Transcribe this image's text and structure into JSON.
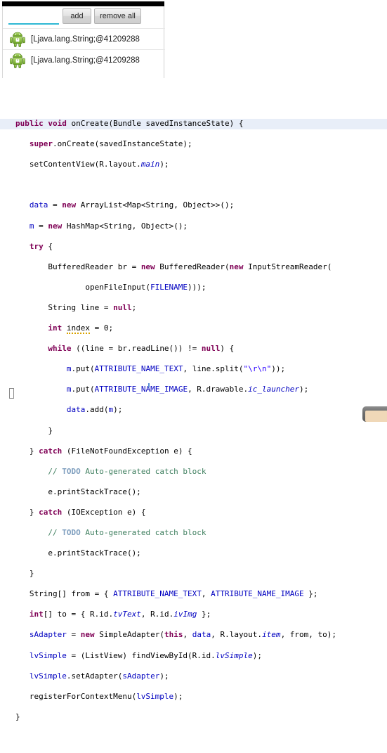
{
  "emulator": {
    "name": "android-emulator-screenshot",
    "status_bar": "",
    "input": {
      "value": "",
      "placeholder": ""
    },
    "buttons": [
      {
        "id": "add",
        "label": "add"
      },
      {
        "id": "remove-all",
        "label": "remove all"
      }
    ],
    "list_items": [
      {
        "icon": "android-robot-icon",
        "text": "[Ljava.lang.String;@41209288"
      },
      {
        "icon": "android-robot-icon",
        "text": "[Ljava.lang.String;@41209288"
      }
    ]
  },
  "editor": {
    "language": "java",
    "highlighted_line": 1,
    "colors": {
      "keyword": "#7f0055",
      "field": "#0000c0",
      "string": "#2a00ff",
      "comment": "#3f7f5f",
      "todo_tag": "#7f9fbf",
      "current_line_background": "#e8eef8"
    },
    "lines": [
      "public void onCreate(Bundle savedInstanceState) {",
      "   super.onCreate(savedInstanceState);",
      "   setContentView(R.layout.main);",
      "",
      "   data = new ArrayList<Map<String, Object>>();",
      "   m = new HashMap<String, Object>();",
      "   try {",
      "       BufferedReader br = new BufferedReader(new InputStreamReader(",
      "               openFileInput(FILENAME)));",
      "       String line = null;",
      "       int index = 0;",
      "       while ((line = br.readLine()) != null) {",
      "           m.put(ATTRIBUTE_NAME_TEXT, line.split(\"\\r\\n\"));",
      "           m.put(ATTRIBUTE_NAME_IMAGE, R.drawable.ic_launcher);",
      "           data.add(m);",
      "       }",
      "   } catch (FileNotFoundException e) {",
      "       // TODO Auto-generated catch block",
      "       e.printStackTrace();",
      "   } catch (IOException e) {",
      "       // TODO Auto-generated catch block",
      "       e.printStackTrace();",
      "   }",
      "   String[] from = { ATTRIBUTE_NAME_TEXT, ATTRIBUTE_NAME_IMAGE };",
      "   int[] to = { R.id.tvText, R.id.ivImg };",
      "   sAdapter = new SimpleAdapter(this, data, R.layout.item, from, to);",
      "   lvSimple = (ListView) findViewById(R.id.lvSimple);",
      "   lvSimple.setAdapter(sAdapter);",
      "   registerForContextMenu(lvSimple);",
      "}"
    ]
  }
}
